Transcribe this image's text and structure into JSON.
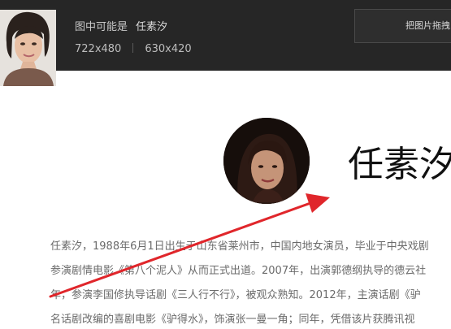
{
  "header": {
    "result_label": "图中可能是",
    "result_name": "任素汐",
    "size_original": "722x480",
    "size_alt": "630x420",
    "drag_button_label": "把图片拖拽"
  },
  "profile": {
    "name": "任素汐"
  },
  "bio_lines": [
    "任素汐，1988年6月1日出生于山东省莱州市，中国内地女演员，毕业于中央戏剧",
    "参演剧情电影《第八个泥人》从而正式出道。2007年，出演郭德纲执导的德云社",
    "年，参演李国修执导话剧《三人行不行》，被观众熟知。2012年，主演话剧《驴",
    "名话剧改编的喜剧电影《驴得水》，饰演张一曼一角；同年，凭借该片获腾讯视"
  ],
  "colors": {
    "header_bg": "#262626",
    "arrow": "#e0262b",
    "body_text": "#6b6b6b"
  }
}
